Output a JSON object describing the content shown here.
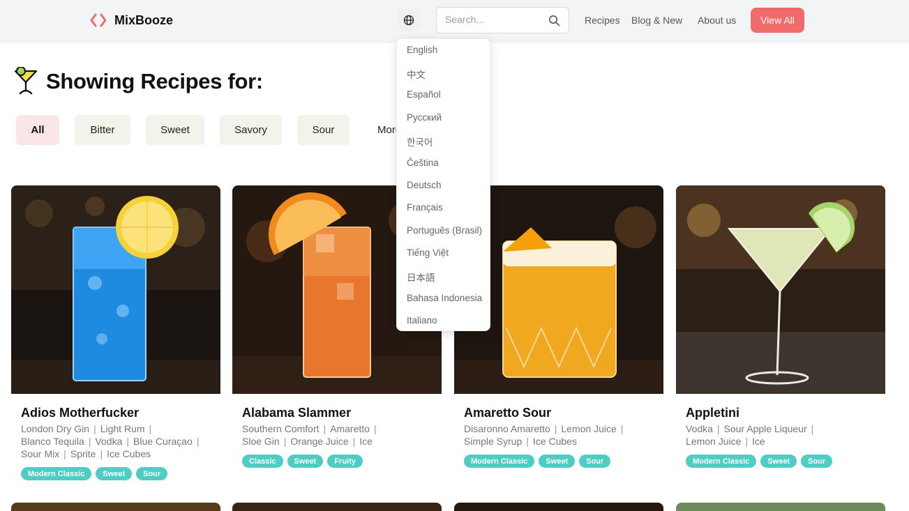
{
  "brand": {
    "name": "MixBooze",
    "accent": "#f26b6b"
  },
  "search": {
    "placeholder": "Search..."
  },
  "nav": {
    "recipes": "Recipes",
    "blog": "Blog & New",
    "about": "About us",
    "view_all": "View All"
  },
  "heading": "Showing Recipes for:",
  "filters": [
    "All",
    "Bitter",
    "Sweet",
    "Savory",
    "Sour",
    "More"
  ],
  "active_filter": "All",
  "languages": [
    "English",
    "中文",
    "Español",
    "Русский",
    "한국어",
    "Čeština",
    "Deutsch",
    "Français",
    "Português (Brasil)",
    "Tiếng Việt",
    "日本語",
    "Bahasa Indonesia",
    "Italiano"
  ],
  "tag_color": "#4ecdc4",
  "cards": [
    {
      "title": "Adios Motherfucker",
      "ingredients": [
        "London Dry Gin",
        "Light Rum",
        "Blanco Tequila",
        "Vodka",
        "Blue Curaçao",
        "Sour Mix",
        "Sprite",
        "Ice Cubes"
      ],
      "tags": [
        "Modern Classic",
        "Sweet",
        "Sour"
      ]
    },
    {
      "title": "Alabama Slammer",
      "ingredients": [
        "Southern Comfort",
        "Amaretto",
        "Sloe Gin",
        "Orange Juice",
        "Ice"
      ],
      "tags": [
        "Classic",
        "Sweet",
        "Fruity"
      ]
    },
    {
      "title": "Amaretto Sour",
      "ingredients": [
        "Disaronno Amaretto",
        "Lemon Juice",
        "Simple Syrup",
        "Ice Cubes"
      ],
      "tags": [
        "Modern Classic",
        "Sweet",
        "Sour"
      ]
    },
    {
      "title": "Appletini",
      "ingredients": [
        "Vodka",
        "Sour Apple Liqueur",
        "Lemon Juice",
        "Ice"
      ],
      "tags": [
        "Modern Classic",
        "Sweet",
        "Sour"
      ]
    }
  ]
}
